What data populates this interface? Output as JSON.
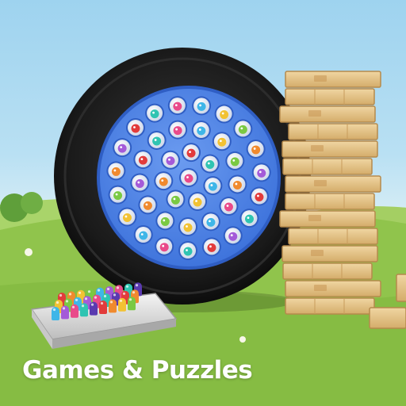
{
  "caption": "Games & Puzzles",
  "colors": {
    "sky": "#a8d8f0",
    "grass": "#8fc24a",
    "tire": "#1c1c1c",
    "board": "#4f86e8",
    "wood": "#e6c48a",
    "caption": "#ffffff"
  },
  "icons": [
    "fishing-game-board-icon",
    "wooden-block-tower-icon",
    "peg-puzzle-icon"
  ]
}
